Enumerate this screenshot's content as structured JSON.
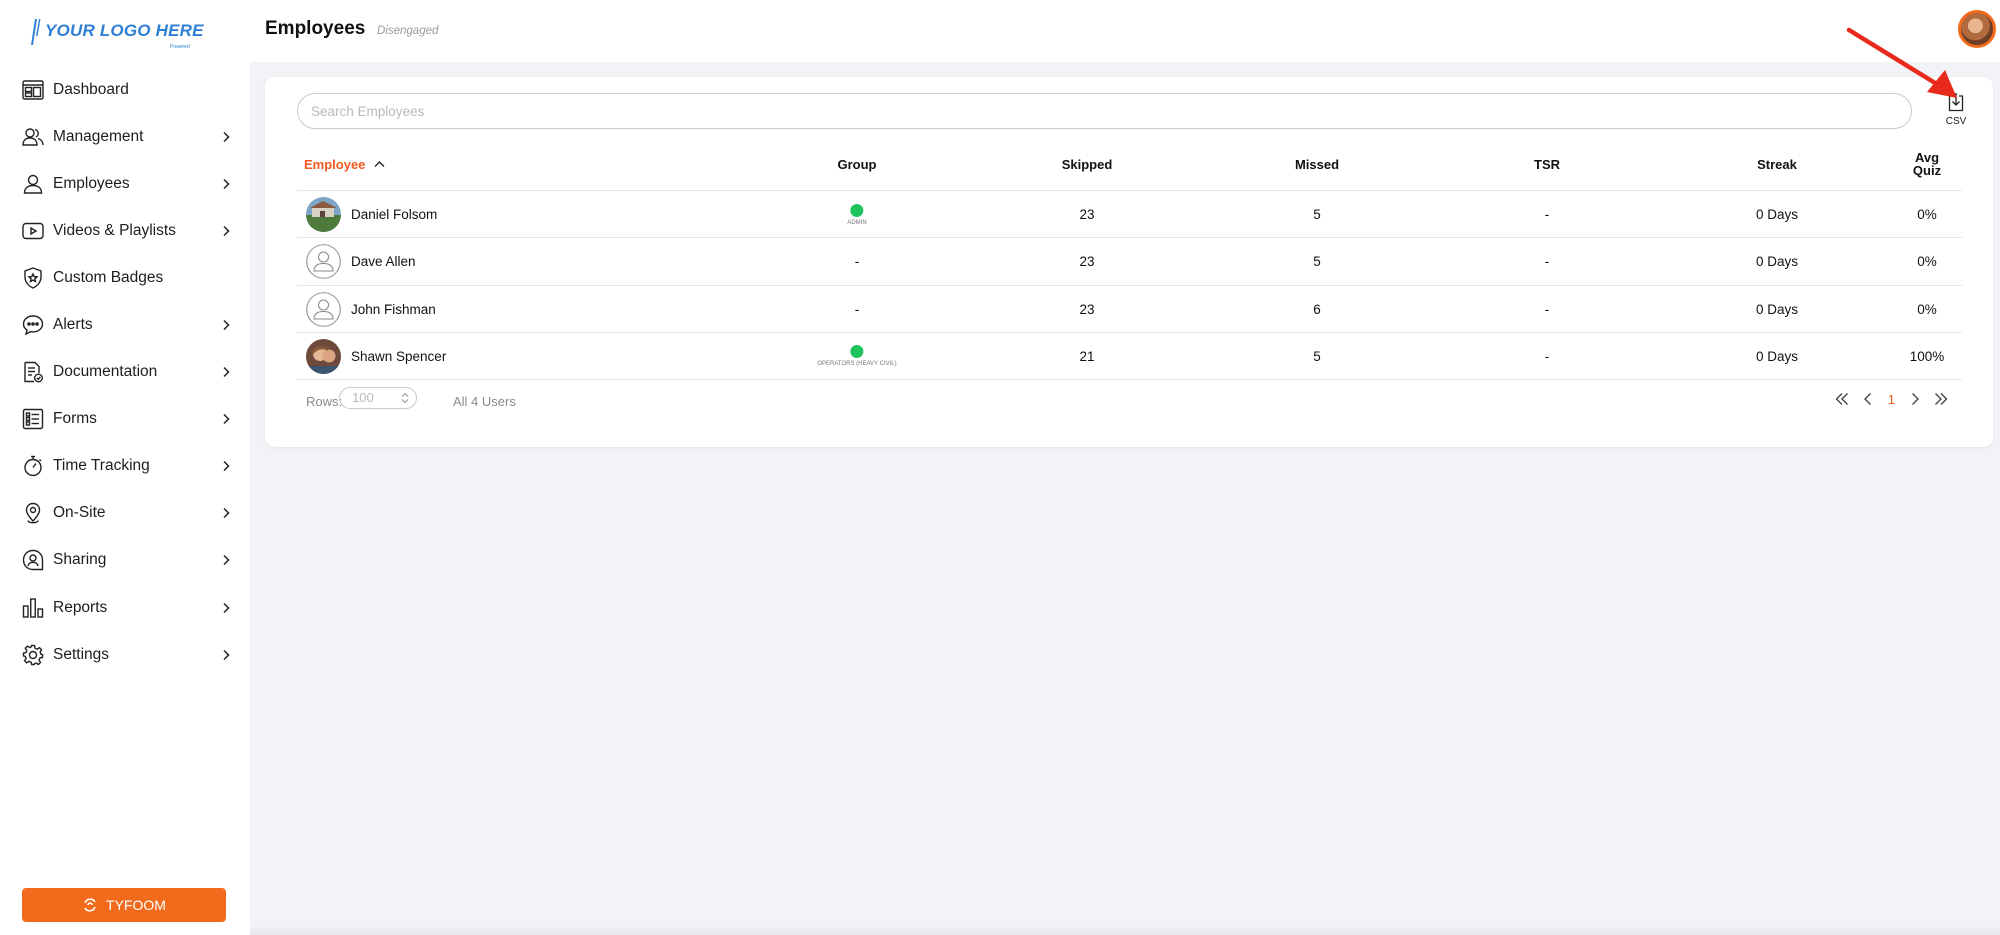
{
  "brand": {
    "logo_text": "YOUR LOGO HERE",
    "logo_sub": "Powered",
    "accent": "#f26b1d",
    "link": "#f05a22",
    "logo_color": "#2f7fd4"
  },
  "sidebar": {
    "items": [
      {
        "label": "Dashboard",
        "icon": "dashboard-icon",
        "chevron": false
      },
      {
        "label": "Management",
        "icon": "management-icon",
        "chevron": true
      },
      {
        "label": "Employees",
        "icon": "employees-icon",
        "chevron": true
      },
      {
        "label": "Videos & Playlists",
        "icon": "video-icon",
        "chevron": true
      },
      {
        "label": "Custom Badges",
        "icon": "badge-icon",
        "chevron": false
      },
      {
        "label": "Alerts",
        "icon": "alerts-icon",
        "chevron": true
      },
      {
        "label": "Documentation",
        "icon": "documentation-icon",
        "chevron": true
      },
      {
        "label": "Forms",
        "icon": "forms-icon",
        "chevron": true
      },
      {
        "label": "Time Tracking",
        "icon": "stopwatch-icon",
        "chevron": true
      },
      {
        "label": "On-Site",
        "icon": "location-pin-icon",
        "chevron": true
      },
      {
        "label": "Sharing",
        "icon": "sharing-icon",
        "chevron": true
      },
      {
        "label": "Reports",
        "icon": "reports-icon",
        "chevron": true
      },
      {
        "label": "Settings",
        "icon": "gear-icon",
        "chevron": true
      }
    ],
    "footer_button": "TYFOOM"
  },
  "header": {
    "title": "Employees",
    "subtitle": "Disengaged"
  },
  "search": {
    "placeholder": "Search Employees",
    "value": ""
  },
  "csv": {
    "label": "CSV"
  },
  "table": {
    "columns": [
      "Employee",
      "Group",
      "Skipped",
      "Missed",
      "TSR",
      "Streak",
      "Avg\nQuiz"
    ],
    "rows": [
      {
        "name": "Daniel Folsom",
        "avatar": "photo-landscape",
        "group": {
          "dot": true,
          "label": "ADMIN"
        },
        "skipped": "23",
        "missed": "5",
        "tsr": "-",
        "streak": "0 Days",
        "avg_quiz": "0%"
      },
      {
        "name": "Dave Allen",
        "avatar": "placeholder",
        "group": {
          "dot": false,
          "label": "-"
        },
        "skipped": "23",
        "missed": "5",
        "tsr": "-",
        "streak": "0 Days",
        "avg_quiz": "0%"
      },
      {
        "name": "John Fishman",
        "avatar": "placeholder",
        "group": {
          "dot": false,
          "label": "-"
        },
        "skipped": "23",
        "missed": "6",
        "tsr": "-",
        "streak": "0 Days",
        "avg_quiz": "0%"
      },
      {
        "name": "Shawn Spencer",
        "avatar": "photo-person",
        "group": {
          "dot": true,
          "label": "OPERATORS (HEAVY CIVIL)"
        },
        "skipped": "21",
        "missed": "5",
        "tsr": "-",
        "streak": "0 Days",
        "avg_quiz": "100%"
      }
    ]
  },
  "footer": {
    "rows_label": "Rows:",
    "rows_value": "100",
    "all_users": "All 4 Users",
    "current_page": "1"
  },
  "colors": {
    "status_green": "#1fc35d",
    "annotation_arrow": "#e8291c"
  }
}
